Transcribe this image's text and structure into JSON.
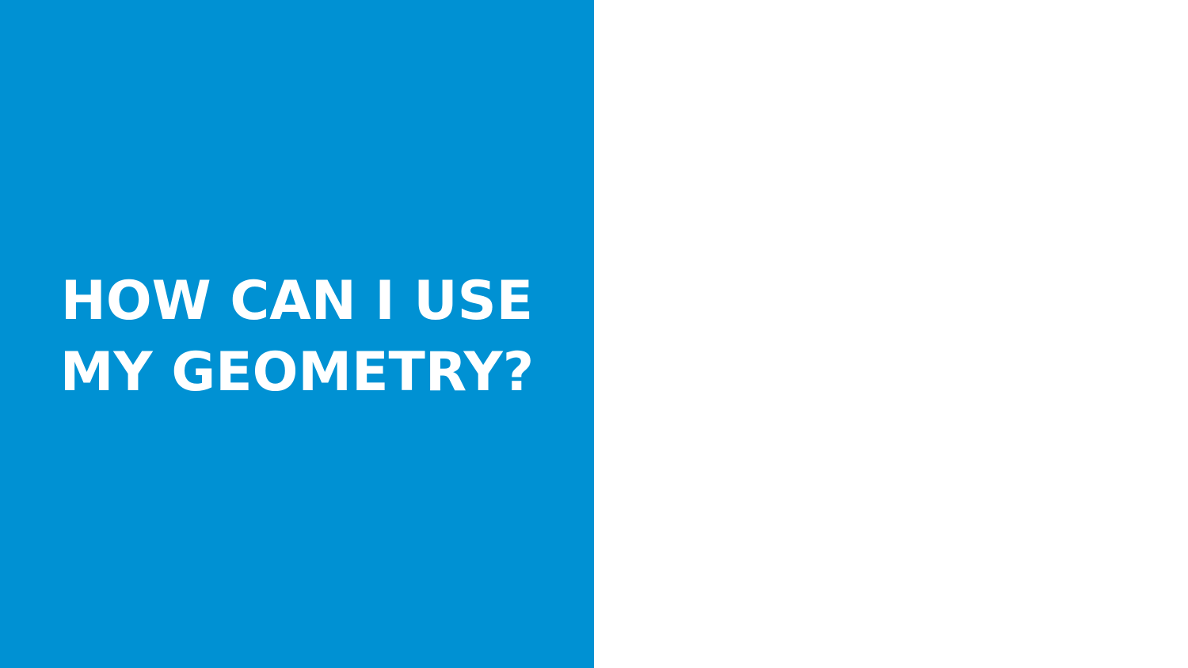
{
  "slide": {
    "title_lines": [
      "HOW CAN I USE",
      "MY GEOMETRY?"
    ]
  },
  "colors": {
    "panel_background": "#0091D3",
    "title_text": "#FFFFFF",
    "right_background": "#FFFFFF"
  }
}
